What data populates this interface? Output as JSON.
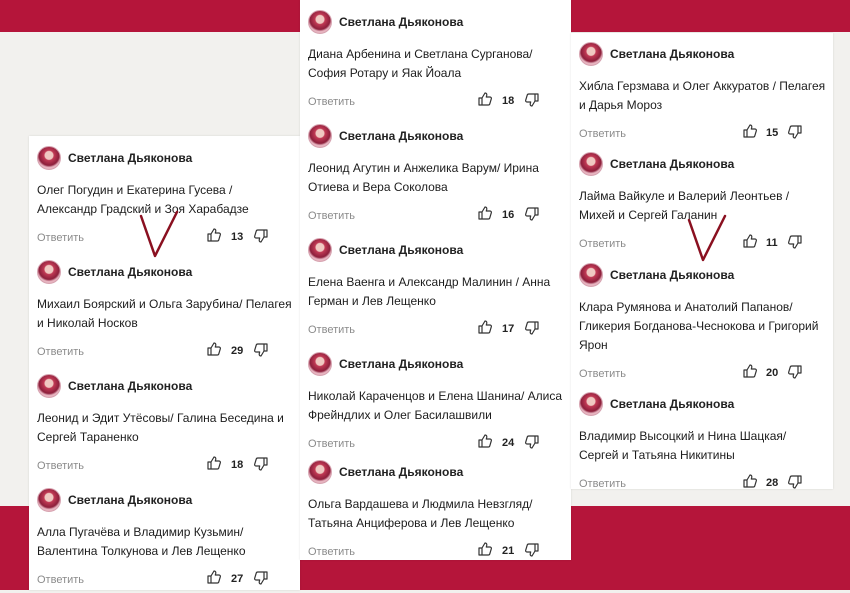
{
  "reply_label": "Ответить",
  "colors": {
    "band": "#b5153a",
    "check": "#8a1020"
  },
  "columns": [
    {
      "comments": [
        {
          "author": "Светлана Дьяконова",
          "text": "Олег Погудин и Екатерина Гусева / Александр Градский и Зоя Харабадзе",
          "likes": "13"
        },
        {
          "author": "Светлана Дьяконова",
          "text": "Михаил Боярский и Ольга Зарубина/ Пелагея и Николай Носков",
          "likes": "29"
        },
        {
          "author": "Светлана Дьяконова",
          "text": "Леонид и Эдит Утёсовы/ Галина Беседина и Сергей Тараненко",
          "likes": "18"
        },
        {
          "author": "Светлана Дьяконова",
          "text": "Алла Пугачёва и Владимир Кузьмин/ Валентина Толкунова и Лев Лещенко",
          "likes": "27"
        }
      ]
    },
    {
      "comments": [
        {
          "author": "Светлана Дьяконова",
          "text": "Диана Арбенина и Светлана Сурганова/ София Ротару и Яак Йоала",
          "likes": "18"
        },
        {
          "author": "Светлана Дьяконова",
          "text": "Леонид Агутин и Анжелика Варум/ Ирина Отиева и Вера Соколова",
          "likes": "16"
        },
        {
          "author": "Светлана Дьяконова",
          "text": "Елена Ваенга и Александр Малинин / Анна Герман и Лев Лещенко",
          "likes": "17"
        },
        {
          "author": "Светлана Дьяконова",
          "text": "Николай Караченцов и Елена Шанина/ Алиса Фрейндлих и Олег Басилашвили",
          "likes": "24"
        },
        {
          "author": "Светлана Дьяконова",
          "text": "Ольга Вардашева и Людмила Невзгляд/ Татьяна Анциферова и Лев Лещенко",
          "likes": "21"
        }
      ]
    },
    {
      "comments": [
        {
          "author": "Светлана Дьяконова",
          "text": "Хибла Герзмава и Олег Аккуратов / Пелагея и Дарья Мороз",
          "likes": "15"
        },
        {
          "author": "Светлана Дьяконова",
          "text": "Лайма Вайкуле и Валерий Леонтьев / Михей и Сергей Галанин",
          "likes": "11"
        },
        {
          "author": "Светлана Дьяконова",
          "text": "Клара Румянова и Анатолий Папанов/ Гликерия Богданова-Чеснокова и Григорий Ярон",
          "likes": "20"
        },
        {
          "author": "Светлана Дьяконова",
          "text": "Владимир Высоцкий и Нина Шацкая/ Сергей и Татьяна Никитины",
          "likes": "28"
        }
      ]
    }
  ]
}
